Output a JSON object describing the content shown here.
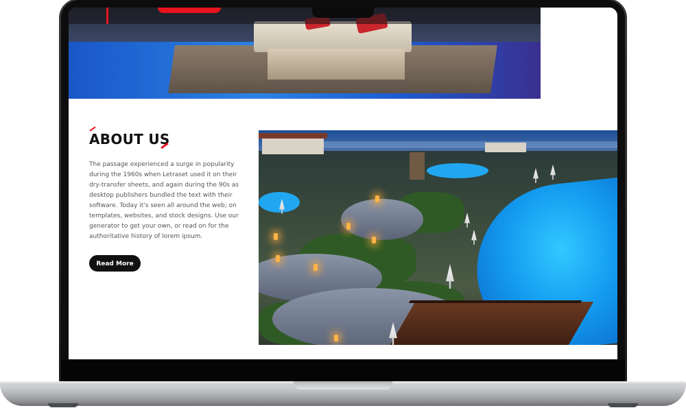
{
  "about": {
    "title": "ABOUT US",
    "body": "The passage experienced a surge in popularity during the 1960s when Letraset used it on their dry-transfer sheets, and again during the 90s as desktop publishers bundled the text with their software. Today it's seen all around the web; on templates, websites, and stock designs. Use our generator to get your own, or read on for the authoritative history of lorem ipsum.",
    "button_label": "Read More"
  },
  "colors": {
    "accent": "#e8141c",
    "button": "#111111",
    "body_text": "#555555"
  }
}
